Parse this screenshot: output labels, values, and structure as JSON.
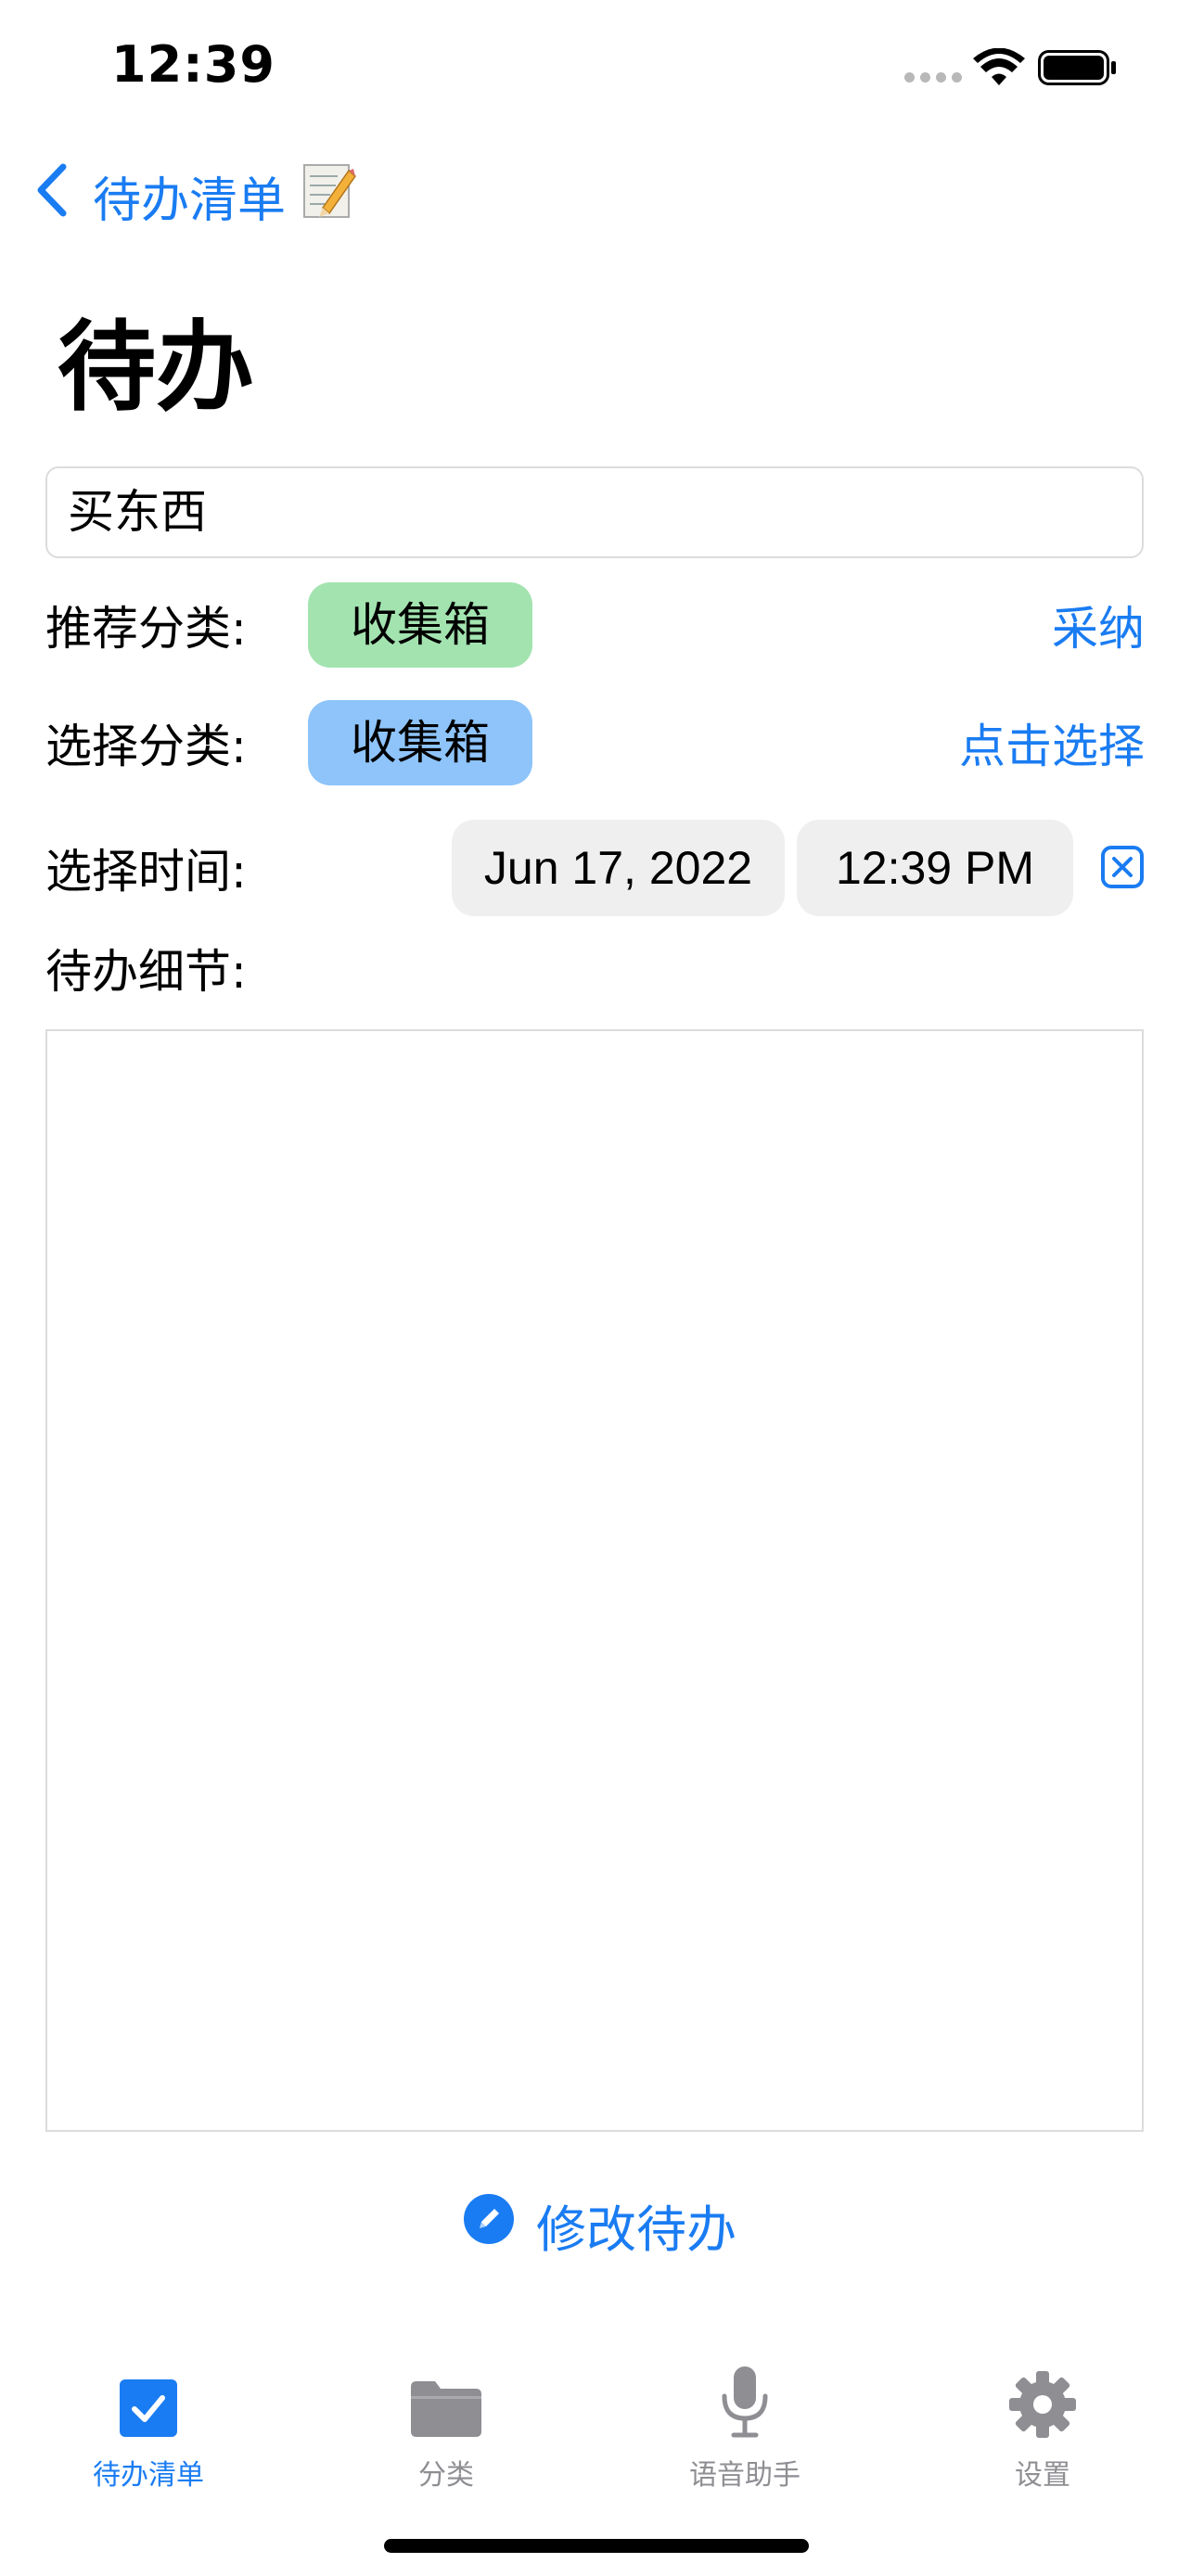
{
  "status_bar": {
    "time": "12:39"
  },
  "nav": {
    "back_label": "待办清单",
    "back_icon": "chevron-left-icon",
    "memo_icon": "memo-pencil-icon"
  },
  "page": {
    "title": "待办"
  },
  "form": {
    "title_value": "买东西",
    "recommended_label": "推荐分类:",
    "recommended_category": "收集箱",
    "accept_label": "采纳",
    "choose_label": "选择分类:",
    "chosen_category": "收集箱",
    "tap_to_choose_label": "点击选择",
    "time_label": "选择时间:",
    "date_value": "Jun 17, 2022",
    "time_value": "12:39 PM",
    "details_label": "待办细节:",
    "details_value": ""
  },
  "actions": {
    "edit_label": "修改待办"
  },
  "tabbar": {
    "tabs": [
      {
        "label": "待办清单",
        "icon": "checkbox-icon",
        "active": true
      },
      {
        "label": "分类",
        "icon": "folder-icon",
        "active": false
      },
      {
        "label": "语音助手",
        "icon": "microphone-icon",
        "active": false
      },
      {
        "label": "设置",
        "icon": "gear-icon",
        "active": false
      }
    ]
  },
  "colors": {
    "accent": "#1a7cf2",
    "chip_green": "#a3e3b0",
    "chip_blue": "#8ec4fa",
    "inactive_tab": "#8e8e93"
  }
}
